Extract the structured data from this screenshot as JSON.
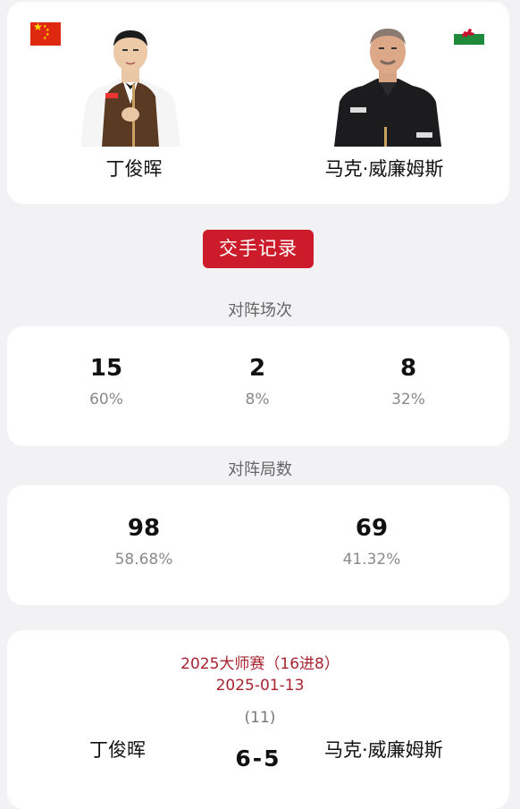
{
  "players": {
    "left": {
      "name": "丁俊晖",
      "flag": "china-flag-icon",
      "flag_color": "#de2910"
    },
    "right": {
      "name": "马克·威廉姆斯",
      "flag": "wales-flag-icon",
      "flag_color": "#1e8a3a"
    }
  },
  "head_to_head": {
    "button_label": "交手记录"
  },
  "matches": {
    "label": "对阵场次",
    "left_wins": "15",
    "left_pct": "60%",
    "draws": "2",
    "draws_pct": "8%",
    "right_wins": "8",
    "right_pct": "32%"
  },
  "frames": {
    "label": "对阵局数",
    "left": "98",
    "left_pct": "58.68%",
    "right": "69",
    "right_pct": "41.32%"
  },
  "recent_match": {
    "event": "2025大师赛（16进8）",
    "date": "2025-01-13",
    "frames": "(11)",
    "left_player": "丁俊晖",
    "score": "6-5",
    "right_player": "马克·威廉姆斯"
  },
  "accent_color": "#cc1b2a"
}
